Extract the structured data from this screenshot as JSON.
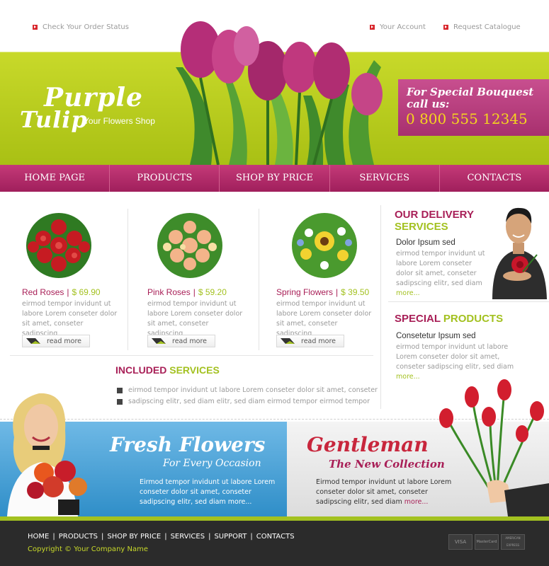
{
  "top_links": {
    "order_status": "Check Your Order Status",
    "account": "Your Account",
    "catalogue": "Request Catalogue"
  },
  "logo": {
    "line1": "Purple",
    "line2": "Tulip",
    "tagline": "Your Flowers Shop"
  },
  "call": {
    "line1": "For Special Bouquest",
    "line2": "call us:",
    "phone": "0 800 555 12345"
  },
  "nav": [
    "HOME PAGE",
    "PRODUCTS",
    "SHOP BY PRICE",
    "SERVICES",
    "CONTACTS"
  ],
  "products": [
    {
      "name": "Red Roses",
      "price": "$ 69.90",
      "desc": "eirmod tempor invidunt ut labore Lorem conseter dolor sit amet, conseter sadipscing",
      "button": "read more"
    },
    {
      "name": "Pink Roses",
      "price": "$ 59.20",
      "desc": "eirmod tempor invidunt ut labore Lorem conseter dolor sit amet, conseter sadipscing",
      "button": "read more"
    },
    {
      "name": "Spring Flowers",
      "price": "$ 39.50",
      "desc": "eirmod tempor invidunt ut labore Lorem conseter dolor sit amet, conseter sadipscing",
      "button": "read more"
    }
  ],
  "included": {
    "title_a": "INCLUDED",
    "title_b": "SERVICES",
    "items": [
      "eirmod tempor invidunt ut labore Lorem conseter dolor sit amet, conseter",
      "sadipscing elitr, sed diam  elitr, sed diam eirmod tempor eirmod tempor"
    ]
  },
  "delivery": {
    "title_a": "OUR DELIVERY",
    "title_b": "SERVICES",
    "subtitle": "Dolor Ipsum sed",
    "desc": "eirmod tempor invidunt ut labore Lorem conseter dolor sit amet, conseter sadipscing elitr, sed diam",
    "more": "more..."
  },
  "special": {
    "title_a": "SPECIAL",
    "title_b": "PRODUCTS",
    "subtitle": "Consetetur Ipsum sed",
    "desc": "eirmod tempor invidunt ut labore Lorem conseter dolor sit amet, conseter sadipscing elitr, sed diam",
    "more": "more..."
  },
  "banner_fresh": {
    "title": "Fresh Flowers",
    "subtitle": "For Every Occasion",
    "text": "Eirmod tempor invidunt ut labore Lorem conseter dolor sit amet, conseter sadipscing elitr, sed diam",
    "more": "more..."
  },
  "banner_gentleman": {
    "title": "Gentleman",
    "subtitle": "The New Collection",
    "text": "Eirmod tempor invidunt ut labore Lorem conseter dolor sit amet, conseter sadipscing elitr, sed diam",
    "more": "more..."
  },
  "footer": {
    "nav": [
      "HOME",
      "PRODUCTS",
      "SHOP BY PRICE",
      "SERVICES",
      "SUPPORT",
      "CONTACTS"
    ],
    "copyright": "Copyright © Your Company Name",
    "cards": [
      "VISA",
      "MasterCard",
      "AMERICAN EXPRESS"
    ]
  },
  "colors": {
    "accent": "#a81f57",
    "green": "#a3c120",
    "nav": "#b32a68",
    "header": "#bcd01e"
  }
}
